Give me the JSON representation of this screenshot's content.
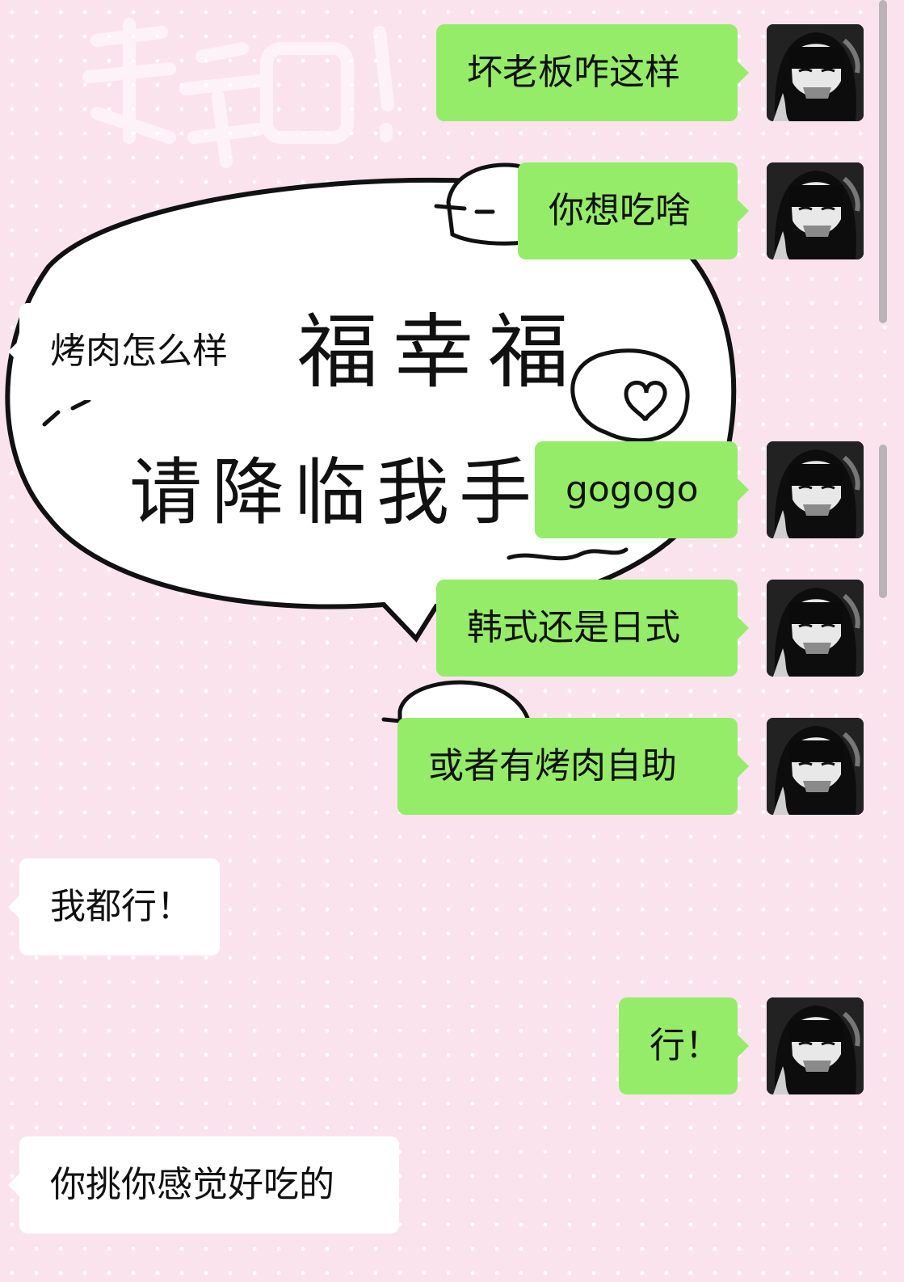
{
  "background": {
    "color": "#fbe3ee",
    "sticker_lines": [
      "幸福幸福",
      "请降临我手"
    ]
  },
  "messages": [
    {
      "from": "me",
      "text": "坏老板咋这样"
    },
    {
      "from": "me",
      "text": "你想吃啥"
    },
    {
      "from": "them",
      "text": "烤肉怎么样"
    },
    {
      "from": "me",
      "text": "gogogo"
    },
    {
      "from": "me",
      "text": "韩式还是日式"
    },
    {
      "from": "me",
      "text": "或者有烤肉自助"
    },
    {
      "from": "them",
      "text": "我都行！"
    },
    {
      "from": "me",
      "text": "行！"
    },
    {
      "from": "them",
      "text": "你挑你感觉好吃的"
    }
  ],
  "colors": {
    "my_bubble": "#95ec69",
    "their_bubble": "#ffffff"
  },
  "avatar_icon": "anime-girl-avatar-icon"
}
